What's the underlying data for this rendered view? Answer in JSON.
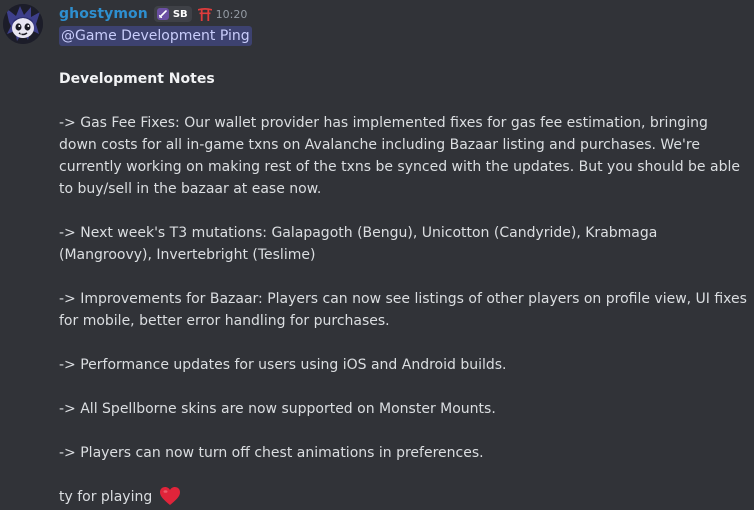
{
  "message": {
    "author": "ghostymon",
    "tag": "SB",
    "timestamp": "10:20",
    "mention": "@Game Development Ping",
    "title": "Development Notes",
    "paragraphs": [
      "-> Gas Fee Fixes: Our wallet provider has implemented fixes for gas fee estimation, bringing down costs for all in-game txns on Avalanche including Bazaar listing and purchases. We're currently working on making rest of the txns be synced with the updates. But you should be able to buy/sell in the bazaar at ease now.",
      "-> Next week's T3 mutations: Galapagoth (Bengu), Unicotton (Candyride), Krabmaga (Mangroovy), Invertebright (Teslime)",
      "-> Improvements for Bazaar: Players can now see listings of other players on profile view, UI fixes for mobile, better error handling for purchases.",
      "-> Performance updates for users using iOS and Android builds.",
      "-> All Spellborne skins are now supported on Monster Mounts.",
      "-> Players can now turn off chest animations in preferences."
    ],
    "closing": "ty for playing",
    "icons": {
      "avatar": "ghost-avatar",
      "tag_icon": "sword-icon",
      "badge": "torii-gate-icon",
      "emoji": "red-heart-emoji"
    }
  },
  "colors": {
    "background": "#313338",
    "username": "#2e8fcf",
    "mention_bg": "#3d4270",
    "mention_text": "#c9cdfb",
    "text": "#dbdee1",
    "timestamp": "#949ba4",
    "heart": "#e0243a",
    "torii": "#e03c3c"
  }
}
